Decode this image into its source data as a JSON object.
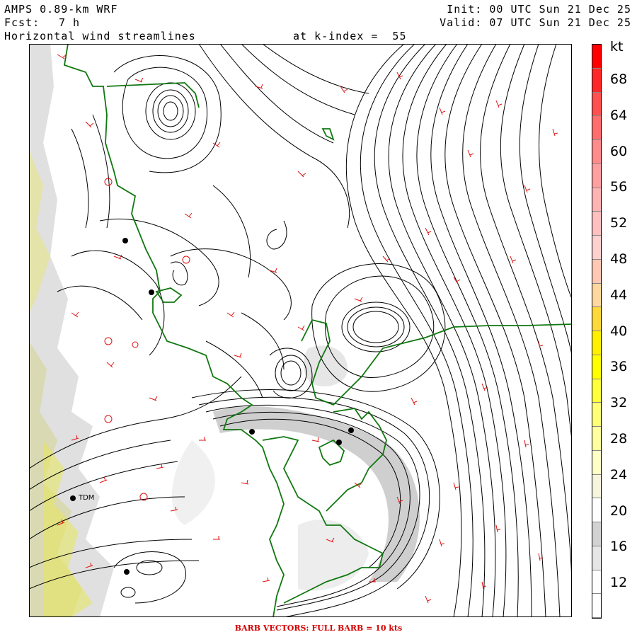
{
  "header": {
    "model": "AMPS 0.89-km WRF",
    "fcst_label": "Fcst:",
    "fcst_value": "7 h",
    "field": "Horizontal wind streamlines",
    "level": "at k-index =  55",
    "init": "Init: 00 UTC Sun 21 Dec 25",
    "valid": "Valid: 07 UTC Sun 21 Dec 25"
  },
  "colorbar": {
    "unit": "kt",
    "labels": [
      "68",
      "64",
      "60",
      "56",
      "52",
      "48",
      "44",
      "40",
      "36",
      "32",
      "28",
      "24",
      "20",
      "16",
      "12"
    ],
    "colors": [
      "#ffffff",
      "#ffffff",
      "#e6e6e6",
      "#d2d2d2",
      "#ffffff",
      "#f6f6de",
      "#ffffc8",
      "#ffffa0",
      "#ffff78",
      "#ffff3c",
      "#ffff00",
      "#fff000",
      "#ffd83c",
      "#ffd8a0",
      "#ffc8b4",
      "#ffd0d0",
      "#ffc0c0",
      "#ffb4b4",
      "#ffa0a0",
      "#ff8c8c",
      "#ff6e6e",
      "#ff5050",
      "#ff2828",
      "#ff0000"
    ]
  },
  "stations": [
    {
      "name": "TDM"
    }
  ],
  "footer": "BARB VECTORS:  FULL BARB = 10 kts",
  "colors": {
    "coastline": "#107810",
    "streamline": "#000000",
    "barb": "#e01010",
    "terrain_gray": "#cfcfcf",
    "terrain_yellow": "#e8e85a"
  }
}
